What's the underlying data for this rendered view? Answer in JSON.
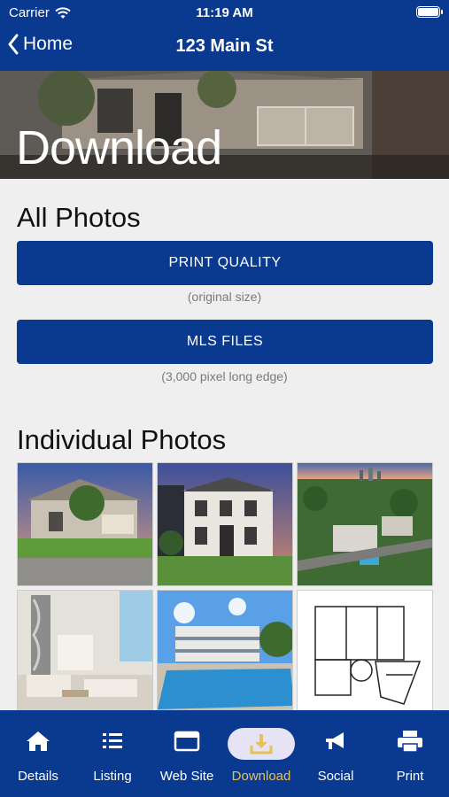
{
  "status": {
    "carrier": "Carrier",
    "time": "11:19 AM"
  },
  "nav": {
    "back_label": "Home",
    "title": "123 Main St"
  },
  "hero": {
    "title": "Download"
  },
  "all_photos": {
    "heading": "All Photos",
    "print_button": "PRINT QUALITY",
    "print_note": "(original size)",
    "mls_button": "MLS FILES",
    "mls_note": "(3,000 pixel long edge)"
  },
  "individual_photos": {
    "heading": "Individual Photos",
    "thumbnails": [
      {
        "name": "photo-house-front-1"
      },
      {
        "name": "photo-house-front-2"
      },
      {
        "name": "photo-aerial"
      },
      {
        "name": "photo-living-room"
      },
      {
        "name": "photo-pool"
      },
      {
        "name": "photo-floor-plan"
      }
    ]
  },
  "tabs": [
    {
      "label": "Details",
      "icon": "home-icon"
    },
    {
      "label": "Listing",
      "icon": "list-icon"
    },
    {
      "label": "Web Site",
      "icon": "browser-icon"
    },
    {
      "label": "Download",
      "icon": "download-icon",
      "active": true
    },
    {
      "label": "Social",
      "icon": "megaphone-icon"
    },
    {
      "label": "Print",
      "icon": "printer-icon"
    }
  ],
  "colors": {
    "brand": "#0a3a8f",
    "active_tab_label": "#e8c05a",
    "active_pill": "#e6e3f5"
  }
}
